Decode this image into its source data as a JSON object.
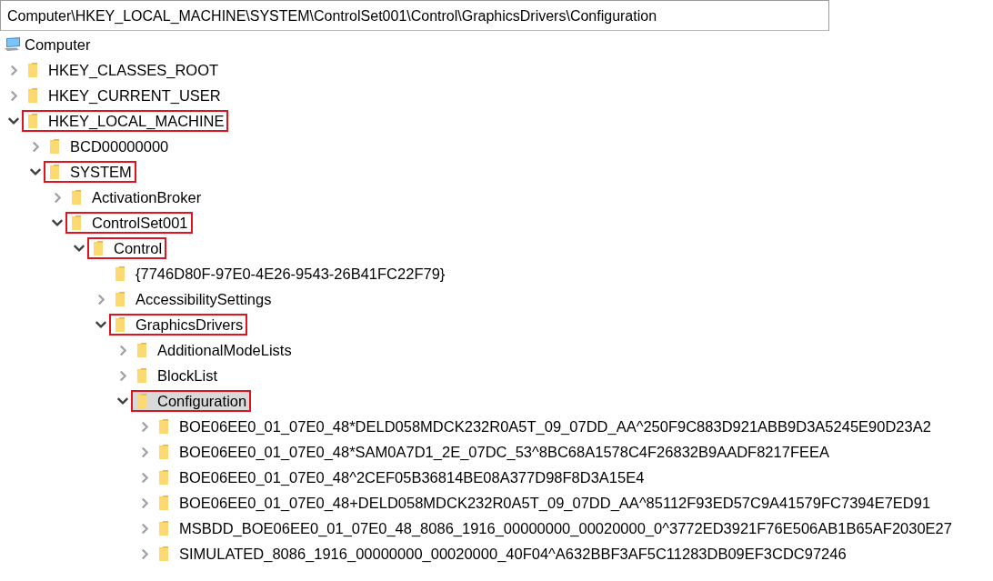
{
  "address_bar": {
    "value": "Computer\\HKEY_LOCAL_MACHINE\\SYSTEM\\ControlSet001\\Control\\GraphicsDrivers\\Configuration"
  },
  "tree": [
    {
      "label": "Computer",
      "kind": "computer",
      "children": [
        {
          "label": "HKEY_CLASSES_ROOT",
          "kind": "folder",
          "expandable": true,
          "expanded": false,
          "highlighted": false,
          "selected": false
        },
        {
          "label": "HKEY_CURRENT_USER",
          "kind": "folder",
          "expandable": true,
          "expanded": false,
          "highlighted": false,
          "selected": false
        },
        {
          "label": "HKEY_LOCAL_MACHINE",
          "kind": "folder",
          "expandable": true,
          "expanded": true,
          "highlighted": true,
          "selected": false,
          "children": [
            {
              "label": "BCD00000000",
              "kind": "folder",
              "expandable": true,
              "expanded": false,
              "highlighted": false,
              "selected": false
            },
            {
              "label": "SYSTEM",
              "kind": "folder",
              "expandable": true,
              "expanded": true,
              "highlighted": true,
              "selected": false,
              "children": [
                {
                  "label": "ActivationBroker",
                  "kind": "folder",
                  "expandable": true,
                  "expanded": false,
                  "highlighted": false,
                  "selected": false
                },
                {
                  "label": "ControlSet001",
                  "kind": "folder",
                  "expandable": true,
                  "expanded": true,
                  "highlighted": true,
                  "selected": false,
                  "children": [
                    {
                      "label": "Control",
                      "kind": "folder",
                      "expandable": true,
                      "expanded": true,
                      "highlighted": true,
                      "selected": false,
                      "children": [
                        {
                          "label": "{7746D80F-97E0-4E26-9543-26B41FC22F79}",
                          "kind": "folder",
                          "expandable": false,
                          "highlighted": false,
                          "selected": false
                        },
                        {
                          "label": "AccessibilitySettings",
                          "kind": "folder",
                          "expandable": true,
                          "expanded": false,
                          "highlighted": false,
                          "selected": false
                        },
                        {
                          "label": "GraphicsDrivers",
                          "kind": "folder",
                          "expandable": true,
                          "expanded": true,
                          "highlighted": true,
                          "selected": false,
                          "children": [
                            {
                              "label": "AdditionalModeLists",
                              "kind": "folder",
                              "expandable": true,
                              "expanded": false,
                              "highlighted": false,
                              "selected": false
                            },
                            {
                              "label": "BlockList",
                              "kind": "folder",
                              "expandable": true,
                              "expanded": false,
                              "highlighted": false,
                              "selected": false
                            },
                            {
                              "label": "Configuration",
                              "kind": "folder",
                              "expandable": true,
                              "expanded": true,
                              "highlighted": true,
                              "selected": true,
                              "children": [
                                {
                                  "label": "BOE06EE0_01_07E0_48*DELD058MDCK232R0A5T_09_07DD_AA^250F9C883D921ABB9D3A5245E90D23A2",
                                  "kind": "folder",
                                  "expandable": true,
                                  "expanded": false,
                                  "highlighted": false,
                                  "selected": false
                                },
                                {
                                  "label": "BOE06EE0_01_07E0_48*SAM0A7D1_2E_07DC_53^8BC68A1578C4F26832B9AADF8217FEEA",
                                  "kind": "folder",
                                  "expandable": true,
                                  "expanded": false,
                                  "highlighted": false,
                                  "selected": false
                                },
                                {
                                  "label": "BOE06EE0_01_07E0_48^2CEF05B36814BE08A377D98F8D3A15E4",
                                  "kind": "folder",
                                  "expandable": true,
                                  "expanded": false,
                                  "highlighted": false,
                                  "selected": false
                                },
                                {
                                  "label": "BOE06EE0_01_07E0_48+DELD058MDCK232R0A5T_09_07DD_AA^85112F93ED57C9A41579FC7394E7ED91",
                                  "kind": "folder",
                                  "expandable": true,
                                  "expanded": false,
                                  "highlighted": false,
                                  "selected": false
                                },
                                {
                                  "label": "MSBDD_BOE06EE0_01_07E0_48_8086_1916_00000000_00020000_0^3772ED3921F76E506AB1B65AF2030E27",
                                  "kind": "folder",
                                  "expandable": true,
                                  "expanded": false,
                                  "highlighted": false,
                                  "selected": false
                                },
                                {
                                  "label": "SIMULATED_8086_1916_00000000_00020000_40F04^A632BBF3AF5C11283DB09EF3CDC97246",
                                  "kind": "folder",
                                  "expandable": true,
                                  "expanded": false,
                                  "highlighted": false,
                                  "selected": false
                                }
                              ]
                            }
                          ]
                        }
                      ]
                    }
                  ]
                }
              ]
            }
          ]
        }
      ]
    }
  ]
}
